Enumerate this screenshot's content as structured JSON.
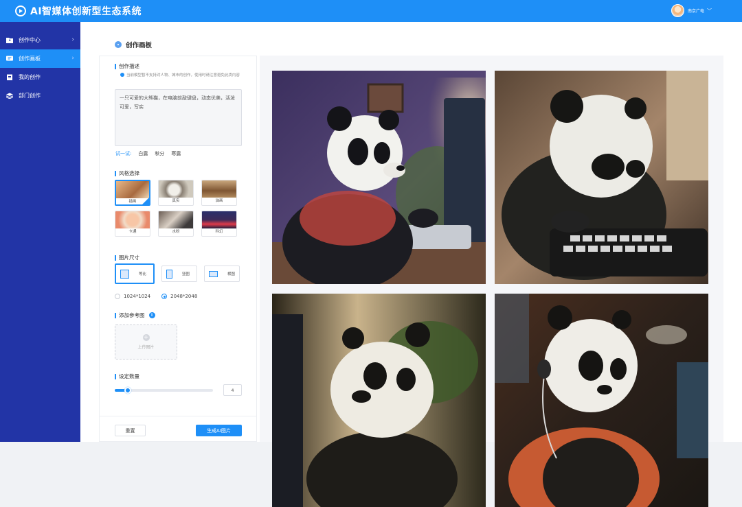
{
  "app": {
    "title": "AI智媒体创新型生态系统"
  },
  "user": {
    "name": "南京广电"
  },
  "sidebar": {
    "items": [
      {
        "label": "创作中心",
        "icon": "folder-icon",
        "active": false,
        "chevron": true
      },
      {
        "label": "创作画板",
        "icon": "board-icon",
        "active": true,
        "chevron": true
      },
      {
        "label": "我的创作",
        "icon": "document-icon",
        "active": false,
        "chevron": false
      },
      {
        "label": "部门创作",
        "icon": "stack-icon",
        "active": false,
        "chevron": false
      }
    ]
  },
  "page": {
    "title": "创作画板"
  },
  "form": {
    "description": {
      "title": "创作描述",
      "notice": "当前模型暂不支持对人物、城市的创作，使用时请注意避免此类内容",
      "value": "一只可爱的大熊猫，在电脑前敲键盘，动态优美，活泼可爱，写实",
      "try_label": "试一试:",
      "try_items": [
        "白露",
        "秋分",
        "寒露"
      ]
    },
    "style": {
      "title": "风格选择",
      "options": [
        {
          "label": "插画",
          "selected": true
        },
        {
          "label": "真实",
          "selected": false
        },
        {
          "label": "油画",
          "selected": false
        },
        {
          "label": "卡通",
          "selected": false
        },
        {
          "label": "水粉",
          "selected": false
        },
        {
          "label": "科幻",
          "selected": false
        }
      ]
    },
    "size": {
      "title": "图片尺寸",
      "options": [
        {
          "label": "等比",
          "selected": true
        },
        {
          "label": "竖图",
          "selected": false
        },
        {
          "label": "横图",
          "selected": false
        }
      ],
      "resolutions": [
        {
          "label": "1024*1024",
          "selected": false
        },
        {
          "label": "2048*2048",
          "selected": true
        }
      ]
    },
    "reference": {
      "title": "添加参考图",
      "info": "i",
      "upload_label": "上传图片",
      "upload_icon": "+"
    },
    "count": {
      "title": "设定数量",
      "value": "4",
      "fraction": 0.13
    },
    "buttons": {
      "reset": "重置",
      "generate": "生成AI图片"
    }
  },
  "colors": {
    "primary": "#1e8ff7",
    "sidebar": "#2234a6"
  },
  "results": {
    "images": [
      {
        "name": "panda-typing-purple-room"
      },
      {
        "name": "panda-closeup-keyboard"
      },
      {
        "name": "panda-window-garden"
      },
      {
        "name": "panda-scarf-headphones"
      }
    ]
  }
}
